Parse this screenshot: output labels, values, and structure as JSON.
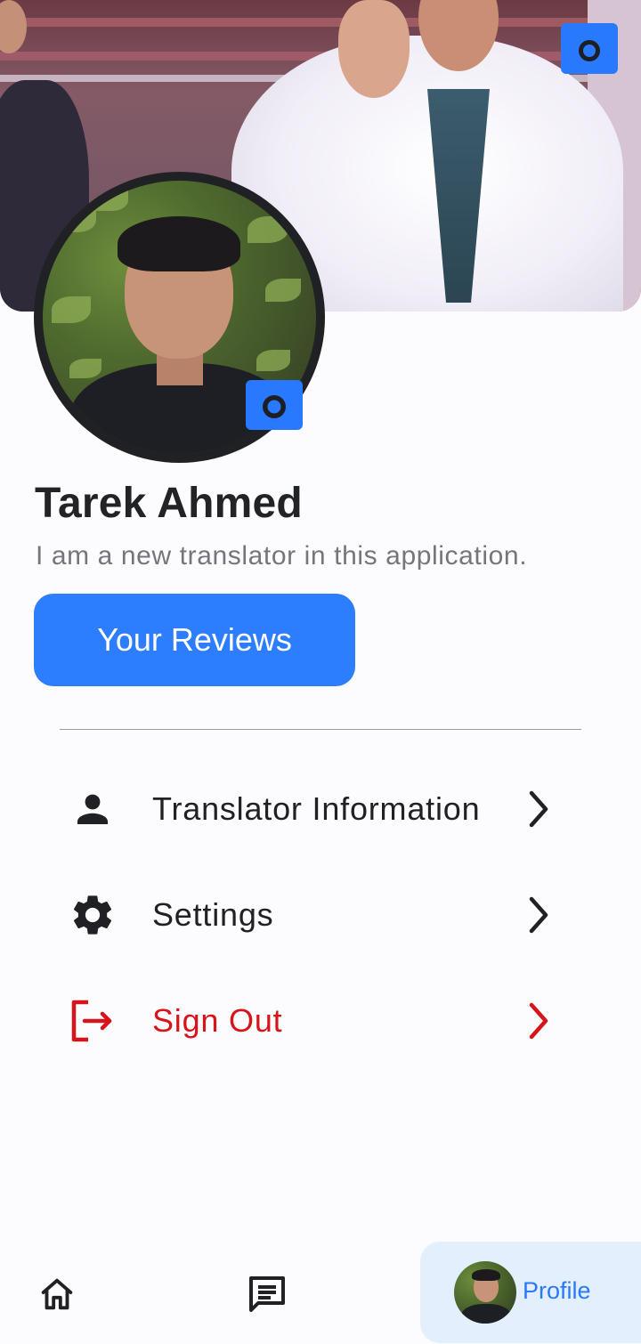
{
  "profile": {
    "name": "Tarek Ahmed",
    "bio": "I am a new translator in this application.",
    "reviews_button": "Your Reviews"
  },
  "menu": {
    "items": [
      {
        "label": "Translator Information",
        "icon": "person-icon",
        "color": "#202124"
      },
      {
        "label": "Settings",
        "icon": "gear-icon",
        "color": "#202124"
      },
      {
        "label": "Sign Out",
        "icon": "logout-icon",
        "color": "#d7141a"
      }
    ]
  },
  "bottom_nav": {
    "items": [
      {
        "icon": "home-icon"
      },
      {
        "icon": "chat-icon"
      },
      {
        "icon": "avatar",
        "label": "Profile",
        "active": true
      }
    ]
  },
  "colors": {
    "accent": "#2979ff",
    "danger": "#d7141a",
    "active_nav_bg": "#e4effd"
  }
}
